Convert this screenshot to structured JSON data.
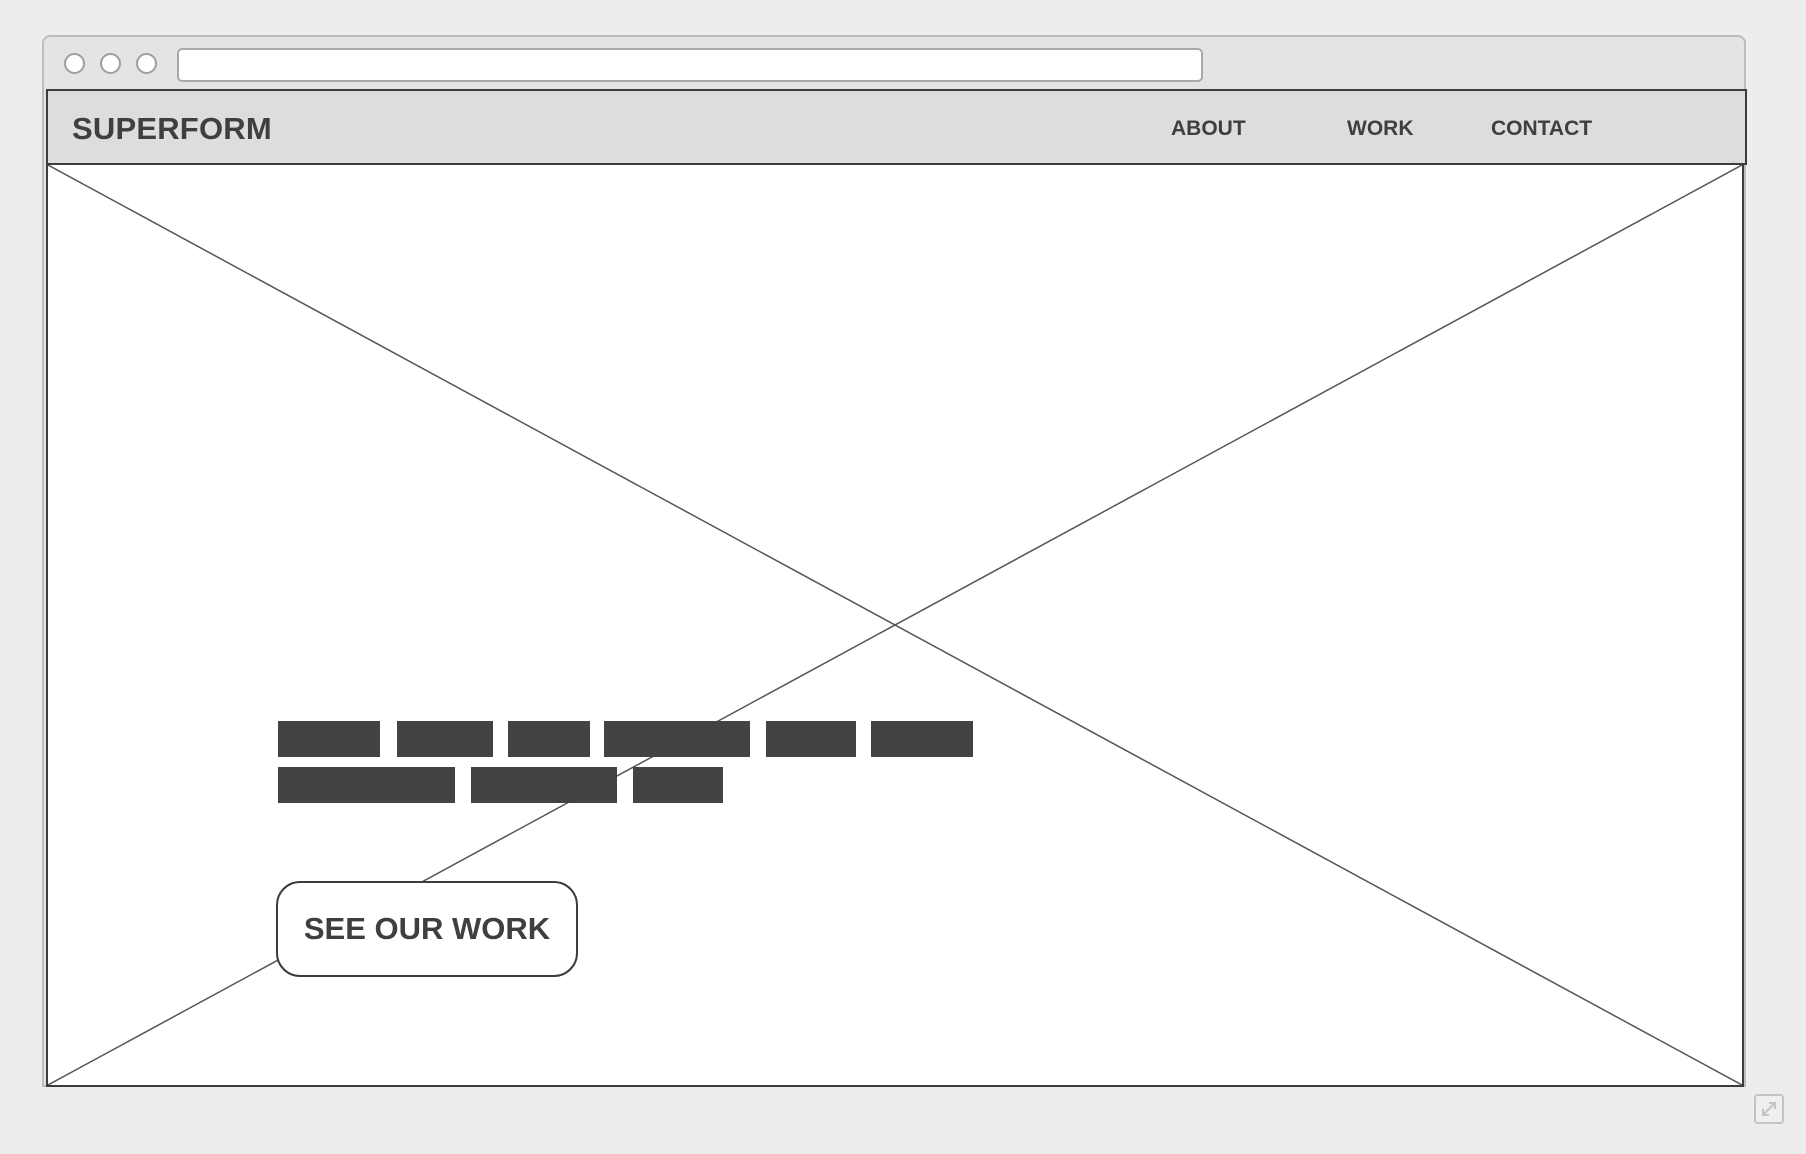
{
  "site": {
    "logo": "SUPERFORM"
  },
  "nav": {
    "items": [
      {
        "label": "ABOUT"
      },
      {
        "label": "WORK"
      },
      {
        "label": "CONTACT"
      }
    ]
  },
  "hero": {
    "placeholder": "image-placeholder",
    "text_lines": 2,
    "cta_label": "SEE OUR WORK"
  },
  "icons": {
    "expand": "expand-icon"
  },
  "colors": {
    "background": "#ededed",
    "header": "#dddddd",
    "text": "#3f3f3f",
    "placeholder_text_block": "#434343",
    "outline": "#3c3c3c"
  }
}
